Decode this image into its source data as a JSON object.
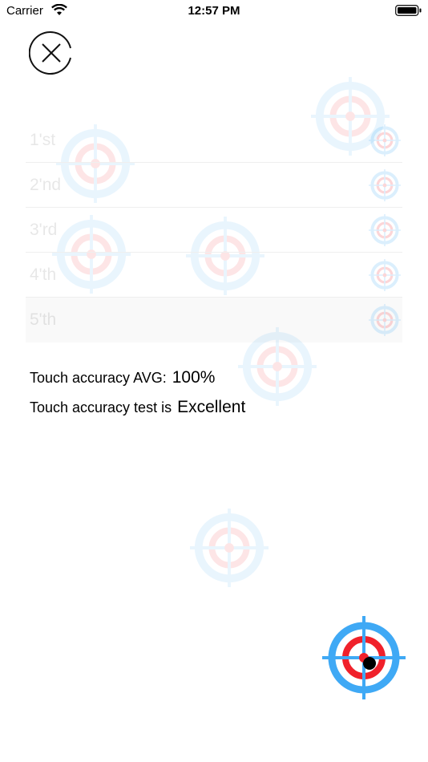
{
  "status_bar": {
    "carrier": "Carrier",
    "time": "12:57 PM"
  },
  "results": {
    "rows": [
      {
        "label": "1'st"
      },
      {
        "label": "2'nd"
      },
      {
        "label": "3'rd"
      },
      {
        "label": "4'th"
      },
      {
        "label": "5'th"
      }
    ]
  },
  "summary": {
    "avg_label": "Touch accuracy AVG:",
    "avg_value": "100%",
    "test_label": "Touch accuracy test is",
    "test_value": "Excellent"
  },
  "colors": {
    "target_blue": "#3fa9f5",
    "target_red": "#f0212b",
    "touch_dot": "#000000"
  },
  "icons": {
    "close": "close-icon",
    "target": "target-icon",
    "wifi": "wifi-icon",
    "battery": "battery-icon"
  }
}
